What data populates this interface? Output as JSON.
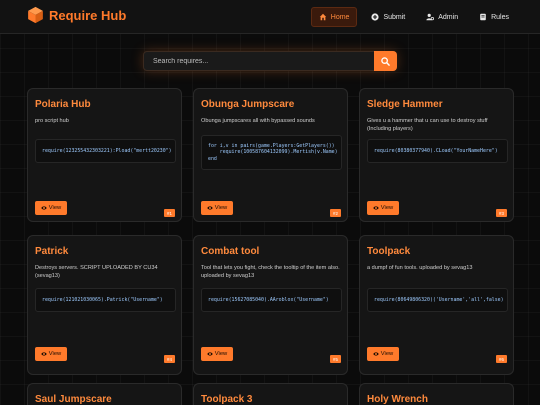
{
  "brand": {
    "name": "Require Hub"
  },
  "nav": [
    {
      "label": "Home",
      "icon": "home-icon",
      "active": true
    },
    {
      "label": "Submit",
      "icon": "plus-circle-icon",
      "active": false
    },
    {
      "label": "Admin",
      "icon": "user-cog-icon",
      "active": false
    },
    {
      "label": "Rules",
      "icon": "book-icon",
      "active": false
    }
  ],
  "search": {
    "placeholder": "Search requires...",
    "button_icon": "search-icon"
  },
  "view_label": "View",
  "cards": [
    {
      "title": "Polaria Hub",
      "desc": "pro script hub",
      "code": "require(123255432303221):Pload(\"mertt20230\")",
      "badge": "#1"
    },
    {
      "title": "Obunga Jumpscare",
      "desc": "Obunga jumpscares all with bypassed sounds",
      "code": "for i,v in pairs(game.Players:GetPlayers())\n    require(100587604132099).Mertish(v.Name)\nend",
      "badge": "#2"
    },
    {
      "title": "Sledge Hammer",
      "desc": "Gives u a hammer that u can use to destroy stuff (Including players)",
      "code": "require(80380377940).CLoad(\"YourNameHere\")",
      "badge": "#3"
    },
    {
      "title": "Patrick",
      "desc": "Destroys servers. SCRIPT UPLOADED BY CU34 (sevag13)",
      "code": "require(121021030065).Patrick(\"Username\")",
      "badge": "#4"
    },
    {
      "title": "Combat tool",
      "desc": "Tool that lets you fight, check the tooltip of the item also. uploaded by sevag13",
      "code": "require(15627085040).AAroblox(\"Username\")",
      "badge": "#5"
    },
    {
      "title": "Toolpack",
      "desc": "a dumpf of fun tools. uploaded by sevag13",
      "code": "require(80649806320)('Username','all',false)",
      "badge": "#6"
    },
    {
      "title": "Saul Jumpscare"
    },
    {
      "title": "Toolpack 3"
    },
    {
      "title": "Holy Wrench"
    }
  ]
}
